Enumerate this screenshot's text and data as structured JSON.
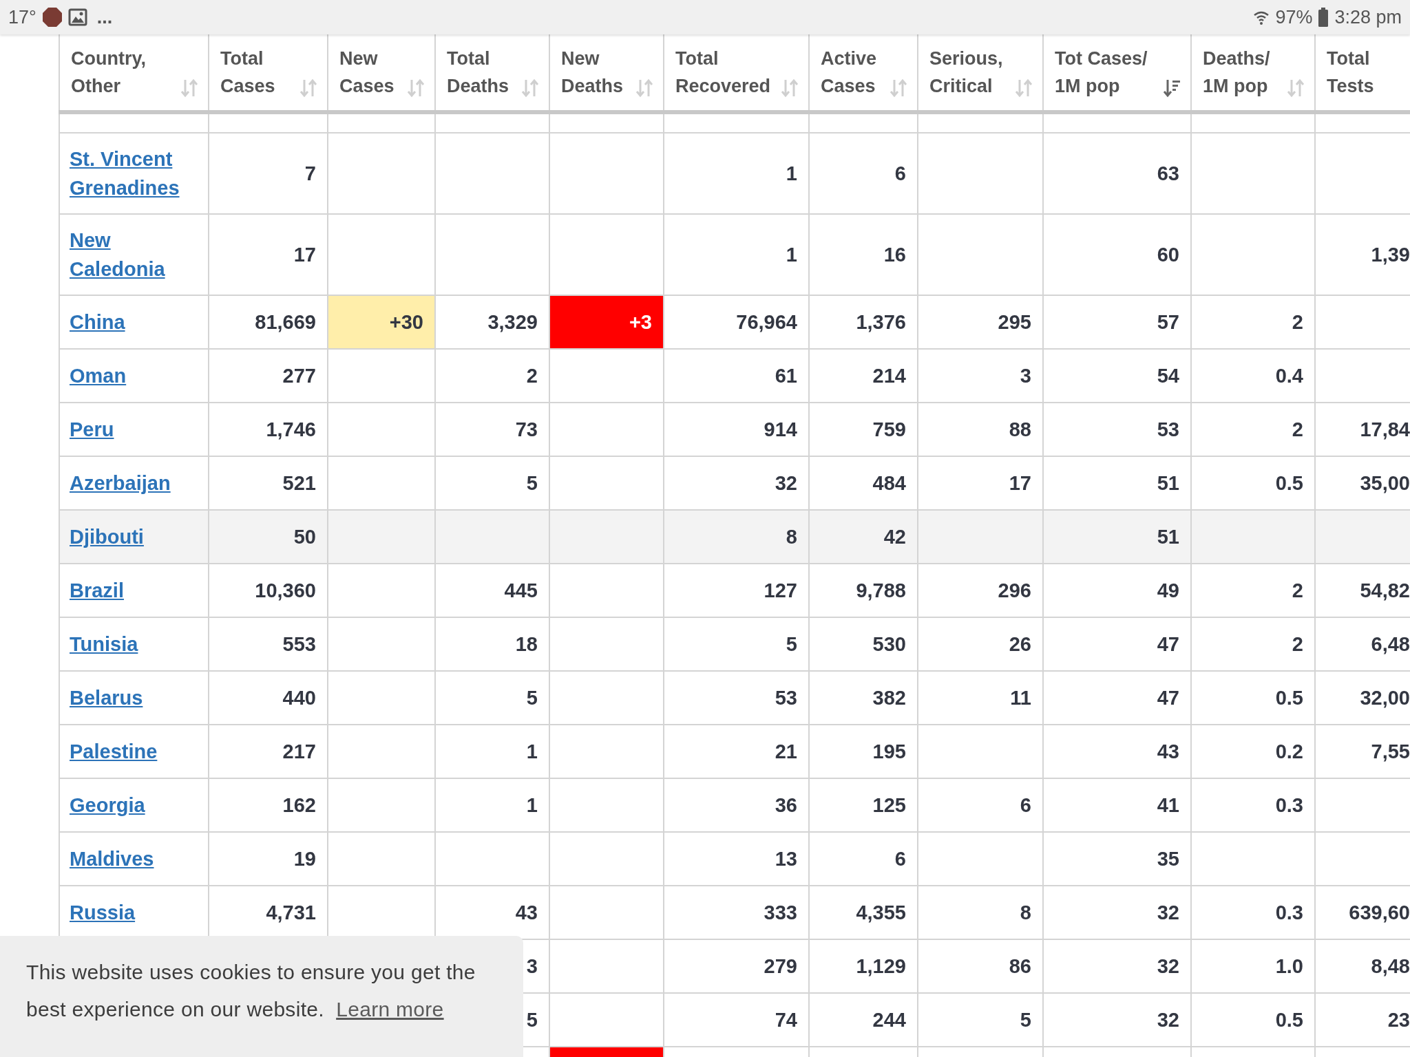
{
  "status_bar": {
    "temperature": "17°",
    "more": "...",
    "battery_percent": "97%",
    "time": "3:28 pm"
  },
  "table": {
    "columns": [
      {
        "label": "Country,\nOther",
        "sort_active": false
      },
      {
        "label": "Total\nCases",
        "sort_active": false
      },
      {
        "label": "New\nCases",
        "sort_active": false
      },
      {
        "label": "Total\nDeaths",
        "sort_active": false
      },
      {
        "label": "New\nDeaths",
        "sort_active": false
      },
      {
        "label": "Total\nRecovered",
        "sort_active": false
      },
      {
        "label": "Active\nCases",
        "sort_active": false
      },
      {
        "label": "Serious,\nCritical",
        "sort_active": false
      },
      {
        "label": "Tot Cases/\n1M pop",
        "sort_active": true
      },
      {
        "label": "Deaths/\n1M pop",
        "sort_active": false
      },
      {
        "label": "Total\nTests"
      }
    ],
    "rows": [
      {
        "shaded": false,
        "cells": [
          {
            "text": "St. Vincent Grenadines",
            "kind": "link"
          },
          {
            "text": "7"
          },
          null,
          null,
          null,
          {
            "text": "1"
          },
          {
            "text": "6"
          },
          null,
          {
            "text": "63"
          },
          null,
          null
        ]
      },
      {
        "shaded": false,
        "cells": [
          {
            "text": "New Caledonia",
            "kind": "link"
          },
          {
            "text": "17"
          },
          null,
          null,
          null,
          {
            "text": "1"
          },
          {
            "text": "16"
          },
          null,
          {
            "text": "60"
          },
          null,
          {
            "text": "1,39"
          }
        ]
      },
      {
        "shaded": false,
        "cells": [
          {
            "text": "China",
            "kind": "link"
          },
          {
            "text": "81,669"
          },
          {
            "text": "+30",
            "color": "#ffeeaa"
          },
          {
            "text": "3,329"
          },
          {
            "text": "+3",
            "color": "#ff0000"
          },
          {
            "text": "76,964"
          },
          {
            "text": "1,376"
          },
          {
            "text": "295"
          },
          {
            "text": "57"
          },
          {
            "text": "2"
          },
          null
        ]
      },
      {
        "shaded": false,
        "cells": [
          {
            "text": "Oman",
            "kind": "link"
          },
          {
            "text": "277"
          },
          null,
          {
            "text": "2"
          },
          null,
          {
            "text": "61"
          },
          {
            "text": "214"
          },
          {
            "text": "3"
          },
          {
            "text": "54"
          },
          {
            "text": "0.4"
          },
          null
        ]
      },
      {
        "shaded": false,
        "cells": [
          {
            "text": "Peru",
            "kind": "link"
          },
          {
            "text": "1,746"
          },
          null,
          {
            "text": "73"
          },
          null,
          {
            "text": "914"
          },
          {
            "text": "759"
          },
          {
            "text": "88"
          },
          {
            "text": "53"
          },
          {
            "text": "2"
          },
          {
            "text": "17,84"
          }
        ]
      },
      {
        "shaded": false,
        "cells": [
          {
            "text": "Azerbaijan",
            "kind": "link"
          },
          {
            "text": "521"
          },
          null,
          {
            "text": "5"
          },
          null,
          {
            "text": "32"
          },
          {
            "text": "484"
          },
          {
            "text": "17"
          },
          {
            "text": "51"
          },
          {
            "text": "0.5"
          },
          {
            "text": "35,00"
          }
        ]
      },
      {
        "shaded": true,
        "cells": [
          {
            "text": "Djibouti",
            "kind": "link"
          },
          {
            "text": "50"
          },
          null,
          null,
          null,
          {
            "text": "8"
          },
          {
            "text": "42"
          },
          null,
          {
            "text": "51"
          },
          null,
          null
        ]
      },
      {
        "shaded": false,
        "cells": [
          {
            "text": "Brazil",
            "kind": "link"
          },
          {
            "text": "10,360"
          },
          null,
          {
            "text": "445"
          },
          null,
          {
            "text": "127"
          },
          {
            "text": "9,788"
          },
          {
            "text": "296"
          },
          {
            "text": "49"
          },
          {
            "text": "2"
          },
          {
            "text": "54,82"
          }
        ]
      },
      {
        "shaded": false,
        "cells": [
          {
            "text": "Tunisia",
            "kind": "link"
          },
          {
            "text": "553"
          },
          null,
          {
            "text": "18"
          },
          null,
          {
            "text": "5"
          },
          {
            "text": "530"
          },
          {
            "text": "26"
          },
          {
            "text": "47"
          },
          {
            "text": "2"
          },
          {
            "text": "6,48"
          }
        ]
      },
      {
        "shaded": false,
        "cells": [
          {
            "text": "Belarus",
            "kind": "link"
          },
          {
            "text": "440"
          },
          null,
          {
            "text": "5"
          },
          null,
          {
            "text": "53"
          },
          {
            "text": "382"
          },
          {
            "text": "11"
          },
          {
            "text": "47"
          },
          {
            "text": "0.5"
          },
          {
            "text": "32,00"
          }
        ]
      },
      {
        "shaded": false,
        "cells": [
          {
            "text": "Palestine",
            "kind": "link"
          },
          {
            "text": "217"
          },
          null,
          {
            "text": "1"
          },
          null,
          {
            "text": "21"
          },
          {
            "text": "195"
          },
          null,
          {
            "text": "43"
          },
          {
            "text": "0.2"
          },
          {
            "text": "7,55"
          }
        ]
      },
      {
        "shaded": false,
        "cells": [
          {
            "text": "Georgia",
            "kind": "link"
          },
          {
            "text": "162"
          },
          null,
          {
            "text": "1"
          },
          null,
          {
            "text": "36"
          },
          {
            "text": "125"
          },
          {
            "text": "6"
          },
          {
            "text": "41"
          },
          {
            "text": "0.3"
          },
          null
        ]
      },
      {
        "shaded": false,
        "cells": [
          {
            "text": "Maldives",
            "kind": "link"
          },
          {
            "text": "19"
          },
          null,
          null,
          null,
          {
            "text": "13"
          },
          {
            "text": "6"
          },
          null,
          {
            "text": "35"
          },
          null,
          null
        ]
      },
      {
        "shaded": false,
        "cells": [
          {
            "text": "Russia",
            "kind": "link"
          },
          {
            "text": "4,731"
          },
          null,
          {
            "text": "43"
          },
          null,
          {
            "text": "333"
          },
          {
            "text": "4,355"
          },
          {
            "text": "8"
          },
          {
            "text": "32"
          },
          {
            "text": "0.3"
          },
          {
            "text": "639,60"
          }
        ]
      },
      {
        "shaded": false,
        "cells": [
          null,
          null,
          null,
          {
            "text": "3"
          },
          null,
          {
            "text": "279"
          },
          {
            "text": "1,129"
          },
          {
            "text": "86"
          },
          {
            "text": "32"
          },
          {
            "text": "1.0"
          },
          {
            "text": "8,48"
          }
        ]
      },
      {
        "shaded": false,
        "cells": [
          null,
          null,
          null,
          {
            "text": "5"
          },
          null,
          {
            "text": "74"
          },
          {
            "text": "244"
          },
          {
            "text": "5"
          },
          {
            "text": "32"
          },
          {
            "text": "0.5"
          },
          {
            "text": "23"
          }
        ]
      },
      {
        "shaded": false,
        "cells": [
          null,
          null,
          null,
          null,
          {
            "color": "#ff0000"
          },
          null,
          null,
          null,
          null,
          null,
          null
        ]
      }
    ]
  },
  "cookie_banner": {
    "message": "This website uses cookies to ensure you get the best experience on our website.",
    "link": "Learn more"
  }
}
